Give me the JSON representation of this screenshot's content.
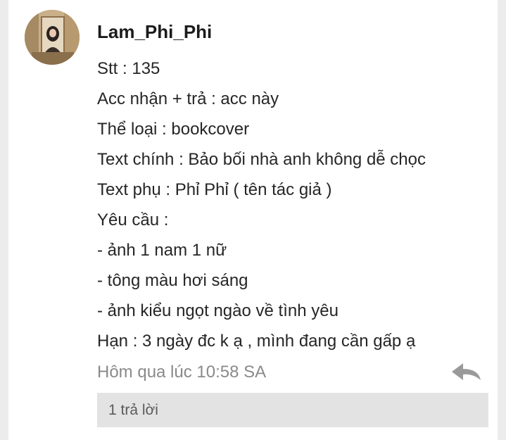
{
  "comment": {
    "username": "Lam_Phi_Phi",
    "lines": [
      "Stt : 135",
      "Acc nhận + trả : acc này",
      "Thể loại : bookcover",
      "Text chính : Bảo bối nhà anh không dễ chọc",
      "Text phụ : Phỉ Phỉ ( tên tác giả )",
      "Yêu cầu :",
      "- ảnh 1 nam 1 nữ",
      "- tông màu hơi sáng",
      "- ảnh kiểu ngọt ngào về tình yêu",
      "Hạn : 3 ngày đc k ạ , mình đang cần gấp ạ"
    ],
    "timestamp": "Hôm qua lúc 10:58 SA",
    "replies_label": "1 trả lời"
  },
  "icons": {
    "reply": "reply-arrow-icon"
  },
  "colors": {
    "page_background": "#ececec",
    "card_background": "#ffffff",
    "text": "#262626",
    "muted_text": "#8a8a8a",
    "replies_bar": "#e3e3e3"
  }
}
